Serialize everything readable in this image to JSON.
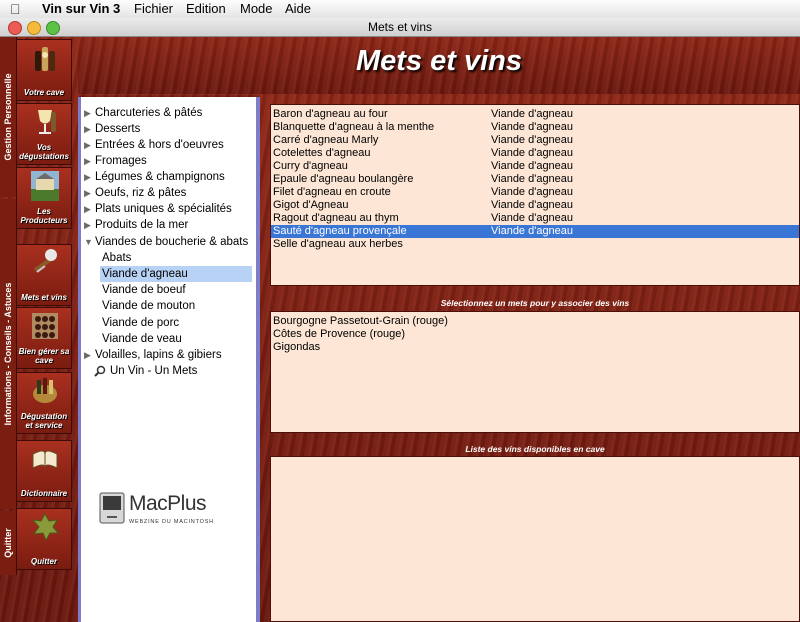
{
  "menubar": {
    "app": "Vin sur Vin 3",
    "items": [
      "Fichier",
      "Edition",
      "Mode",
      "Aide"
    ]
  },
  "window": {
    "title": "Mets et vins"
  },
  "header": {
    "title": "Mets et vins"
  },
  "sidebar": {
    "tabs": [
      "Gestion Personnelle",
      "Informations - Conseils - Astuces",
      "Quitter"
    ],
    "buttons": [
      {
        "label": "Votre cave",
        "icon": "wine-bottles-icon"
      },
      {
        "label": "Vos dégustations",
        "icon": "wine-glass-icon"
      },
      {
        "label": "Les Producteurs",
        "icon": "chateau-icon"
      },
      {
        "label": "Mets et vins",
        "icon": "corkscrew-icon"
      },
      {
        "label": "Bien gérer sa cave",
        "icon": "wine-rack-icon"
      },
      {
        "label": "Dégustation et service",
        "icon": "tasting-icon"
      },
      {
        "label": "Dictionnaire",
        "icon": "book-icon"
      },
      {
        "label": "Quitter",
        "icon": "vine-leaf-icon"
      }
    ]
  },
  "tree": [
    {
      "label": "Charcuteries & pâtés",
      "expandable": true
    },
    {
      "label": "Desserts",
      "expandable": true
    },
    {
      "label": "Entrées & hors d'oeuvres",
      "expandable": true
    },
    {
      "label": "Fromages",
      "expandable": true
    },
    {
      "label": "Légumes & champignons",
      "expandable": true
    },
    {
      "label": "Oeufs, riz & pâtes",
      "expandable": true
    },
    {
      "label": "Plats uniques & spécialités",
      "expandable": true
    },
    {
      "label": "Produits de la mer",
      "expandable": true
    },
    {
      "label": "Viandes de boucherie & abats",
      "expandable": true,
      "expanded": true
    },
    {
      "label": "Abats",
      "child": true
    },
    {
      "label": "Viande d'agneau",
      "child": true,
      "selected": true
    },
    {
      "label": "Viande de boeuf",
      "child": true
    },
    {
      "label": "Viande de mouton",
      "child": true
    },
    {
      "label": "Viande de porc",
      "child": true
    },
    {
      "label": "Viande de veau",
      "child": true
    },
    {
      "label": "Volailles, lapins & gibiers",
      "expandable": true
    },
    {
      "label": "Un Vin - Un Mets",
      "search": true
    }
  ],
  "dishes": [
    {
      "name": "Baron d'agneau au four",
      "category": "Viande d'agneau"
    },
    {
      "name": "Blanquette d'agneau à la menthe",
      "category": "Viande d'agneau"
    },
    {
      "name": "Carré d'agneau Marly",
      "category": "Viande d'agneau"
    },
    {
      "name": "Cotelettes d'agneau",
      "category": "Viande d'agneau"
    },
    {
      "name": "Curry d'agneau",
      "category": "Viande d'agneau"
    },
    {
      "name": "Epaule d'agneau boulangère",
      "category": "Viande d'agneau"
    },
    {
      "name": "Filet d'agneau en croute",
      "category": "Viande d'agneau"
    },
    {
      "name": "Gigot d'Agneau",
      "category": "Viande d'agneau"
    },
    {
      "name": "Ragout d'agneau au thym",
      "category": "Viande d'agneau"
    },
    {
      "name": "Sauté d'agneau provençale",
      "category": "Viande d'agneau",
      "selected": true
    },
    {
      "name": "Selle d'agneau aux herbes",
      "category": ""
    }
  ],
  "wines_section": {
    "title": "Sélectionnez un mets pour y associer des vins"
  },
  "wines": [
    "Bourgogne Passetout-Grain (rouge)",
    "Côtes de Provence (rouge)",
    "Gigondas"
  ],
  "cellar_section": {
    "title": "Liste des vins disponibles en cave"
  },
  "logo": {
    "name": "MacPlus",
    "tagline": "WEBZINE DU MACINTOSH"
  }
}
